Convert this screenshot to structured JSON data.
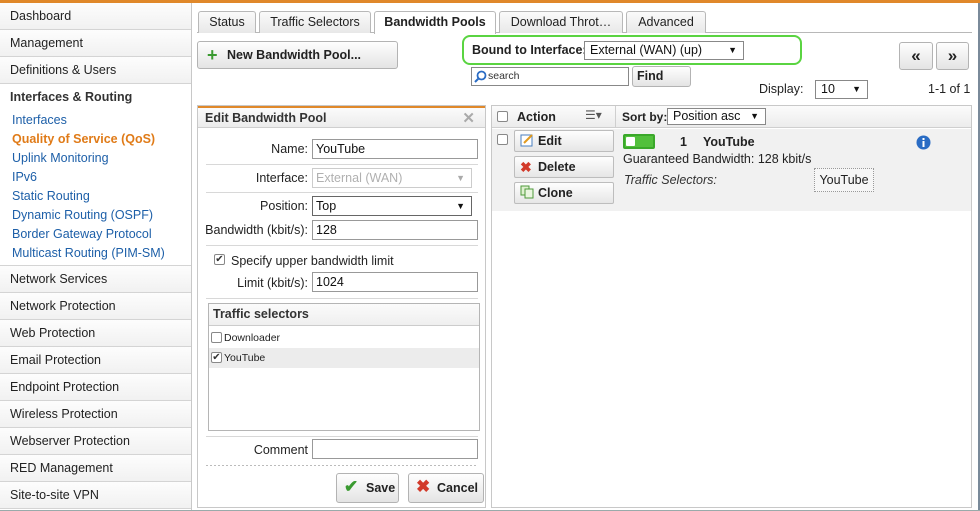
{
  "sidebar": {
    "items_top": [
      "Dashboard",
      "Management",
      "Definitions & Users"
    ],
    "section_title": "Interfaces & Routing",
    "sub_items": [
      "Interfaces",
      "Quality of Service (QoS)",
      "Uplink Monitoring",
      "IPv6",
      "Static Routing",
      "Dynamic Routing (OSPF)",
      "Border Gateway Protocol",
      "Multicast Routing (PIM-SM)"
    ],
    "active_sub": "Quality of Service (QoS)",
    "items_bottom": [
      "Network Services",
      "Network Protection",
      "Web Protection",
      "Email Protection",
      "Endpoint Protection",
      "Wireless Protection",
      "Webserver Protection",
      "RED Management",
      "Site-to-site VPN"
    ]
  },
  "tabs": [
    "Status",
    "Traffic Selectors",
    "Bandwidth Pools",
    "Download Throt…",
    "Advanced"
  ],
  "active_tab": "Bandwidth Pools",
  "toolbar": {
    "new_pool_label": "New Bandwidth Pool...",
    "bound_label": "Bound to Interface:",
    "bound_value": "External (WAN) (up)",
    "search_placeholder": "search",
    "find_label": "Find",
    "prev_label": "«",
    "next_label": "»",
    "display_label": "Display:",
    "display_value": "10",
    "range_text": "1-1 of 1"
  },
  "edit": {
    "title": "Edit Bandwidth Pool",
    "name_label": "Name:",
    "name_value": "YouTube",
    "interface_label": "Interface:",
    "interface_value": "External (WAN)",
    "position_label": "Position:",
    "position_value": "Top",
    "bandwidth_label": "Bandwidth (kbit/s):",
    "bandwidth_value": "128",
    "upper_limit_label": "Specify upper bandwidth limit",
    "limit_label": "Limit (kbit/s):",
    "limit_value": "1024",
    "ts_title": "Traffic selectors",
    "ts_items": [
      {
        "label": "Downloader",
        "checked": false
      },
      {
        "label": "YouTube",
        "checked": true
      }
    ],
    "comment_label": "Comment",
    "comment_value": "",
    "save_label": "Save",
    "cancel_label": "Cancel"
  },
  "list": {
    "action_label": "Action",
    "sort_label": "Sort by:",
    "sort_value": "Position asc",
    "edit_label": "Edit",
    "delete_label": "Delete",
    "clone_label": "Clone",
    "item_number": "1",
    "item_name": "YouTube",
    "guaranteed_text": "Guaranteed Bandwidth: 128 kbit/s",
    "ts_label": "Traffic Selectors:",
    "ts_value": "YouTube"
  },
  "colors": {
    "accent_orange": "#e07b18",
    "link_blue": "#1d5fa8",
    "highlight_green": "#5ad441",
    "toggle_green": "#52c03c"
  }
}
